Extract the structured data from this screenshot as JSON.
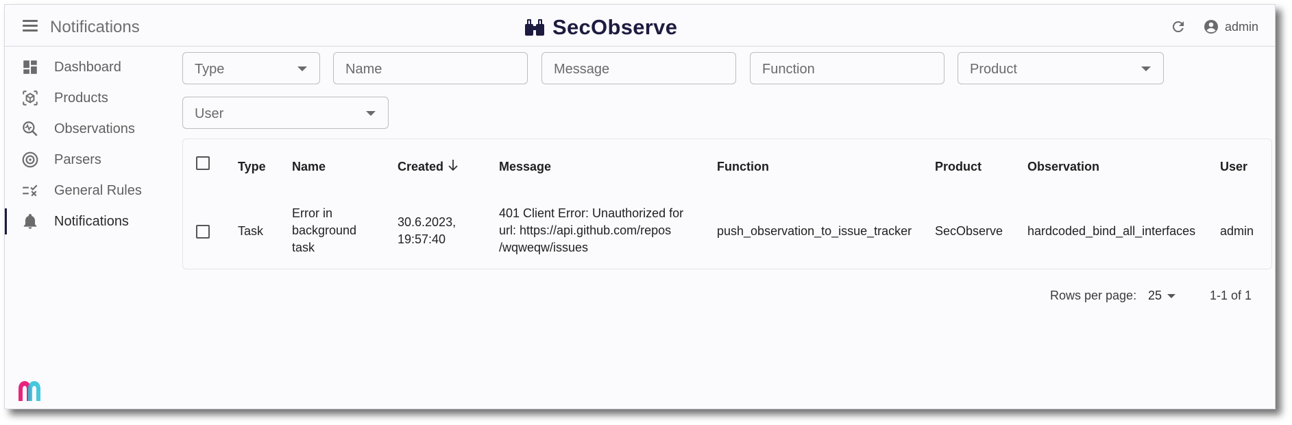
{
  "appbar": {
    "title": "Notifications",
    "brand": "SecObserve",
    "user": "admin"
  },
  "sidebar": {
    "items": [
      {
        "label": "Dashboard",
        "icon": "dashboard-icon"
      },
      {
        "label": "Products",
        "icon": "products-icon"
      },
      {
        "label": "Observations",
        "icon": "observations-icon"
      },
      {
        "label": "Parsers",
        "icon": "parsers-icon"
      },
      {
        "label": "General Rules",
        "icon": "general-rules-icon"
      },
      {
        "label": "Notifications",
        "icon": "bell-icon",
        "active": true
      }
    ]
  },
  "filters": {
    "type": "Type",
    "name": "Name",
    "message": "Message",
    "function": "Function",
    "product": "Product",
    "user": "User"
  },
  "table": {
    "columns": [
      "Type",
      "Name",
      "Created",
      "Message",
      "Function",
      "Product",
      "Observation",
      "User"
    ],
    "sort": {
      "column": "Created",
      "direction": "descending"
    },
    "rows": [
      {
        "type": "Task",
        "name": [
          "Error in",
          "background",
          "task"
        ],
        "created": [
          "30.6.2023,",
          "19:57:40"
        ],
        "message": [
          "401 Client Error: Unauthorized for",
          "url: https://api.github.com/repos",
          "/wqweqw/issues"
        ],
        "function": "push_observation_to_issue_tracker",
        "product": "SecObserve",
        "observation": "hardcoded_bind_all_interfaces",
        "user": "admin"
      }
    ]
  },
  "pagination": {
    "rows_per_page_label": "Rows per page:",
    "rows_per_page": "25",
    "range": "1-1 of 1"
  },
  "colors": {
    "brand": "#1d1b3f",
    "logo_pink": "#e8247f",
    "logo_cyan": "#33c2d8"
  }
}
